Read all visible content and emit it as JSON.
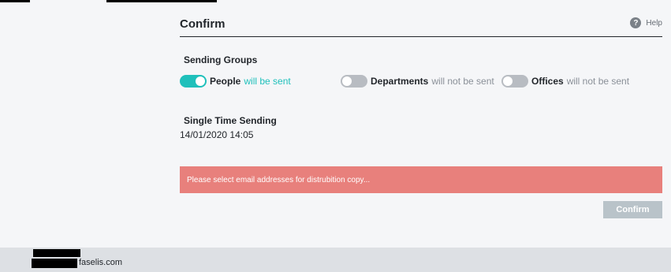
{
  "header": {
    "title": "Confirm",
    "help_label": "Help",
    "help_icon": "question-circle-icon"
  },
  "sending_groups": {
    "label": "Sending Groups",
    "items": [
      {
        "name": "People",
        "status": "will be sent",
        "enabled": true
      },
      {
        "name": "Departments",
        "status": "will not be sent",
        "enabled": false
      },
      {
        "name": "Offices",
        "status": "will not be sent",
        "enabled": false
      }
    ]
  },
  "single_time": {
    "label": "Single Time Sending",
    "datetime": "14/01/2020 14:05"
  },
  "alert": {
    "message": "Please select email addresses for distrubition copy..."
  },
  "actions": {
    "confirm_label": "Confirm"
  },
  "footer": {
    "email": "faselis.com"
  },
  "colors": {
    "accent": "#1fc0bb",
    "alert": "#e8807c",
    "disabled_button": "#b9c3c9"
  }
}
